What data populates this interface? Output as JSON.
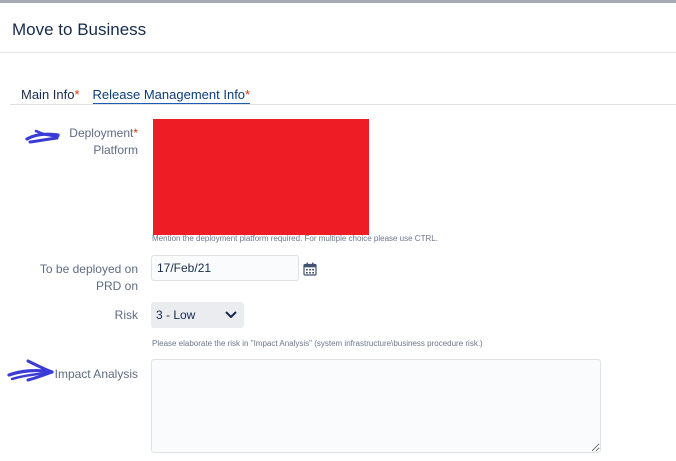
{
  "dialog": {
    "title": "Move to Business"
  },
  "tabs": [
    {
      "label": "Main Info",
      "required_mark": "*",
      "active": false
    },
    {
      "label": "Release Management Info",
      "required_mark": "*",
      "active": true
    }
  ],
  "fields": {
    "deployment_platform": {
      "label_line1": "Deployment",
      "label_line2": "Platform",
      "required_mark": "*",
      "help": "Mention the deployment platform required. For multiple choice please use CTRL."
    },
    "deploy_date": {
      "label_line1": "To be deployed on",
      "label_line2": "PRD on",
      "value": "17/Feb/21",
      "icon": "calendar-icon"
    },
    "risk": {
      "label": "Risk",
      "selected": "3 - Low",
      "icon": "chevron-down-icon",
      "help": "Please elaborate the risk in \"Impact Analysis\" (system infrastructure\\business procedure risk.)"
    },
    "impact_analysis": {
      "label": "Impact Analysis",
      "value": ""
    }
  },
  "colors": {
    "redaction": "#ee1c24",
    "annotation_pen": "#3b3bd6",
    "required": "#de350b",
    "active_tab": "#1e5bb5"
  }
}
